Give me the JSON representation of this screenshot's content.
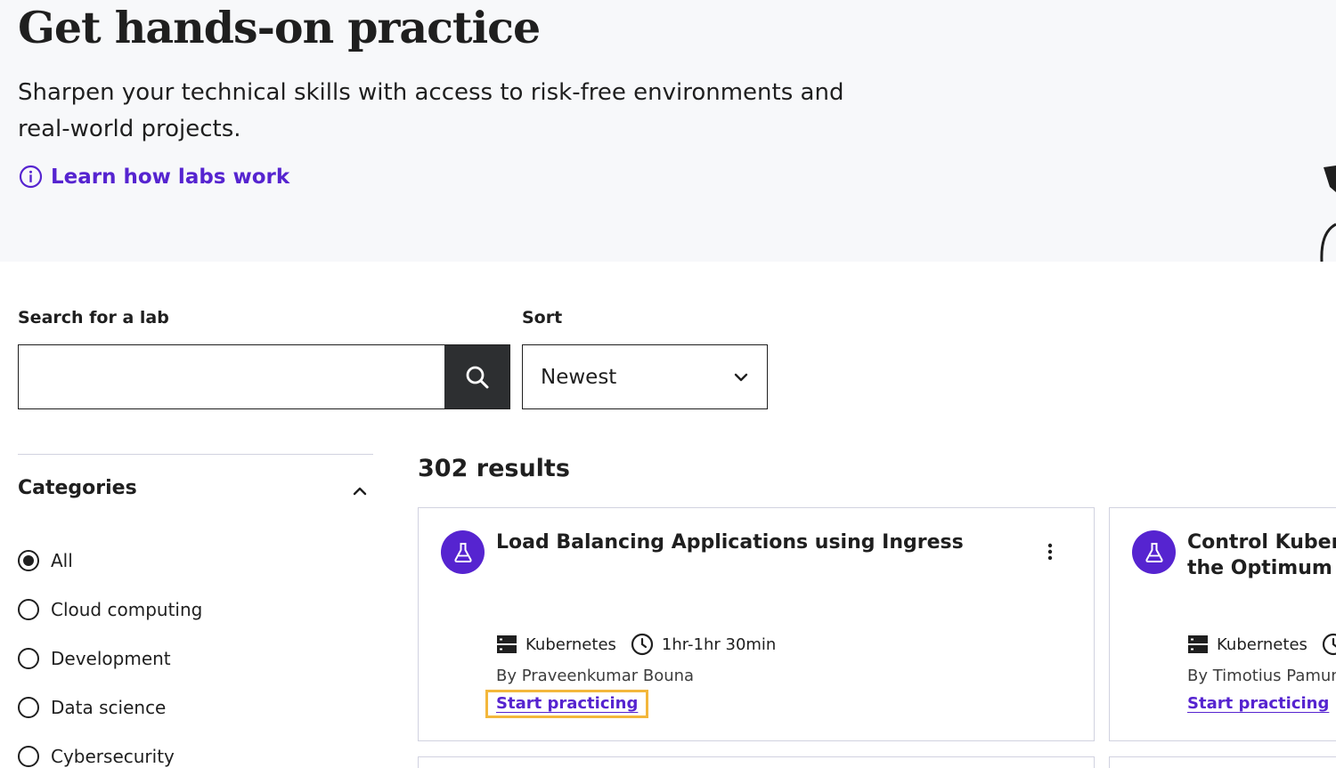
{
  "hero": {
    "title": "Get hands-on practice",
    "subtitle": "Sharpen your technical skills with access to risk-free environments and real-world projects.",
    "learn_link": "Learn how labs work"
  },
  "search": {
    "label": "Search for a lab",
    "value": "",
    "placeholder": ""
  },
  "sort": {
    "label": "Sort",
    "selected": "Newest"
  },
  "categories": {
    "title": "Categories",
    "items": [
      {
        "label": "All",
        "selected": true
      },
      {
        "label": "Cloud computing",
        "selected": false
      },
      {
        "label": "Development",
        "selected": false
      },
      {
        "label": "Data science",
        "selected": false
      },
      {
        "label": "Cybersecurity",
        "selected": false
      }
    ]
  },
  "results": {
    "count_text": "302 results",
    "cards": [
      {
        "title": "Load Balancing Applications using Ingress",
        "tag": "Kubernetes",
        "duration": "1hr-1hr 30min",
        "author": "By Praveenkumar Bouna",
        "cta": "Start practicing"
      },
      {
        "title_line1": "Control Kuberr",
        "title_line2": "the Optimum C",
        "tag": "Kubernetes",
        "author": "By Timotius Pamung",
        "cta": "Start practicing"
      }
    ]
  },
  "colors": {
    "accent": "#5624d0",
    "focus_outline": "#f3b73c",
    "dark": "#2d2f31",
    "hero_bg": "#f7f8fa"
  },
  "icons": [
    "info-icon",
    "search-icon",
    "chevron-down-icon",
    "chevron-up-icon",
    "flask-icon",
    "server-icon",
    "clock-icon",
    "kebab-menu-icon"
  ]
}
